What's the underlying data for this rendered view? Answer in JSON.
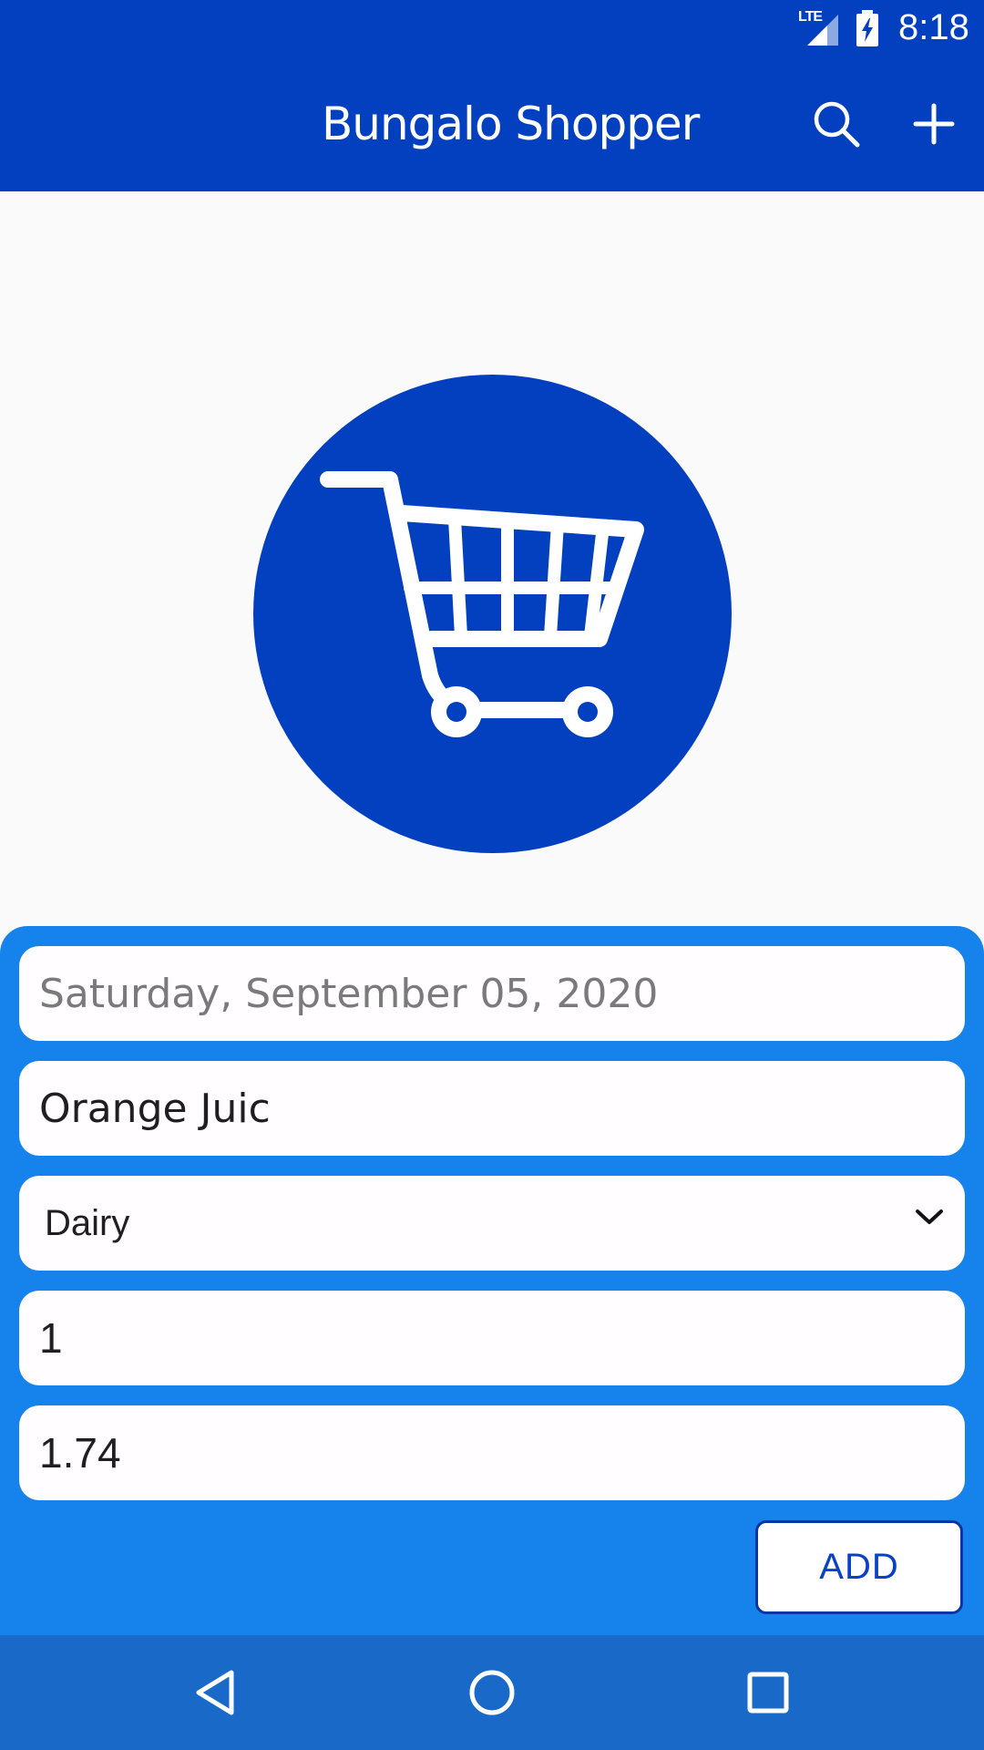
{
  "status_bar": {
    "network": "LTE",
    "time": "8:18",
    "icons": [
      "signal-icon",
      "battery-charging-icon"
    ]
  },
  "app_bar": {
    "title": "Bungalo Shopper",
    "actions": [
      "search-icon",
      "add-icon"
    ]
  },
  "logo": {
    "icon": "shopping-cart-icon"
  },
  "form": {
    "date_field": {
      "placeholder": "Saturday, September 05, 2020",
      "value": ""
    },
    "item_name": {
      "value": "Orange Juic"
    },
    "category": {
      "selected": "Dairy"
    },
    "quantity": {
      "value": "1"
    },
    "price": {
      "value": "1.74"
    },
    "add_button_label": "ADD"
  },
  "nav_bar": {
    "buttons": [
      "back-icon",
      "home-icon",
      "recents-icon"
    ]
  },
  "colors": {
    "primary_dark": "#0340bf",
    "form_panel": "#1682eb",
    "nav_bar": "#1969c9",
    "field_bg": "#fffdff",
    "button_text": "#0a42c7"
  }
}
